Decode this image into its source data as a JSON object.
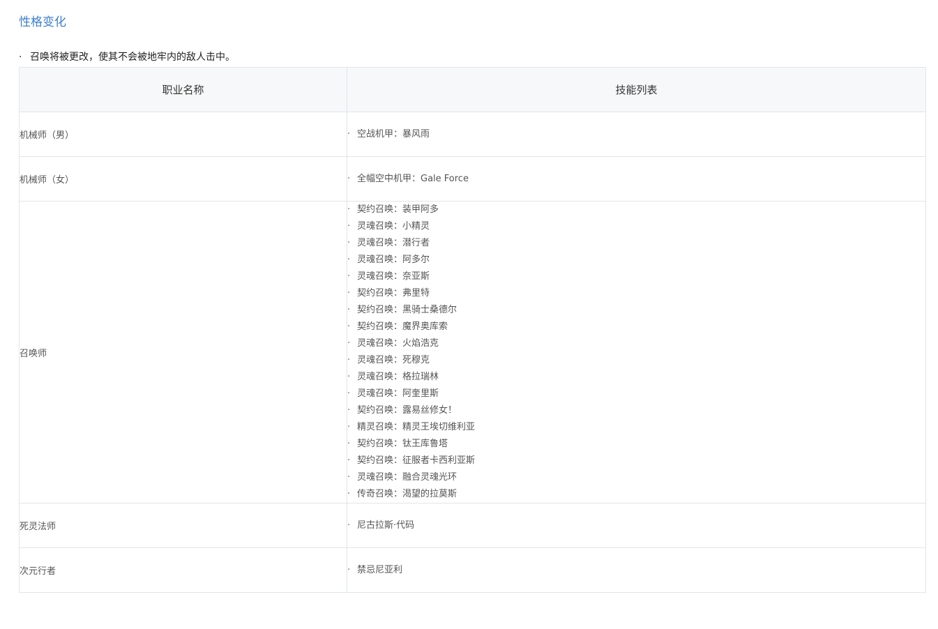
{
  "section_title": "性格变化",
  "intro_text": "召唤将被更改，使其不会被地牢内的敌人击中。",
  "bullet": "·",
  "table": {
    "headers": [
      "职业名称",
      "技能列表"
    ],
    "rows": [
      {
        "job": "机械师（男）",
        "skills": [
          "空战机甲：暴风雨"
        ]
      },
      {
        "job": "机械师（女）",
        "skills": [
          "全幅空中机甲：Gale Force"
        ]
      },
      {
        "job": "召唤师",
        "skills": [
          "契约召唤：装甲阿多",
          "灵魂召唤：小精灵",
          "灵魂召唤：潜行者",
          "灵魂召唤：阿多尔",
          "灵魂召唤：奈亚斯",
          "契约召唤：弗里特",
          "契约召唤：黑骑士桑德尔",
          "契约召唤：魔界奥库索",
          "灵魂召唤：火焰浩克",
          "灵魂召唤：死穆克",
          "灵魂召唤：格拉瑞林",
          "灵魂召唤：阿奎里斯",
          "契约召唤：露易丝修女！",
          "精灵召唤：精灵王埃切维利亚",
          "契约召唤：钛王库鲁塔",
          "契约召唤：征服者卡西利亚斯",
          "灵魂召唤：融合灵魂光环",
          "传奇召唤：渴望的拉莫斯"
        ]
      },
      {
        "job": "死灵法师",
        "skills": [
          "尼古拉斯·代码"
        ]
      },
      {
        "job": "次元行者",
        "skills": [
          "禁忌尼亚利"
        ]
      }
    ]
  }
}
